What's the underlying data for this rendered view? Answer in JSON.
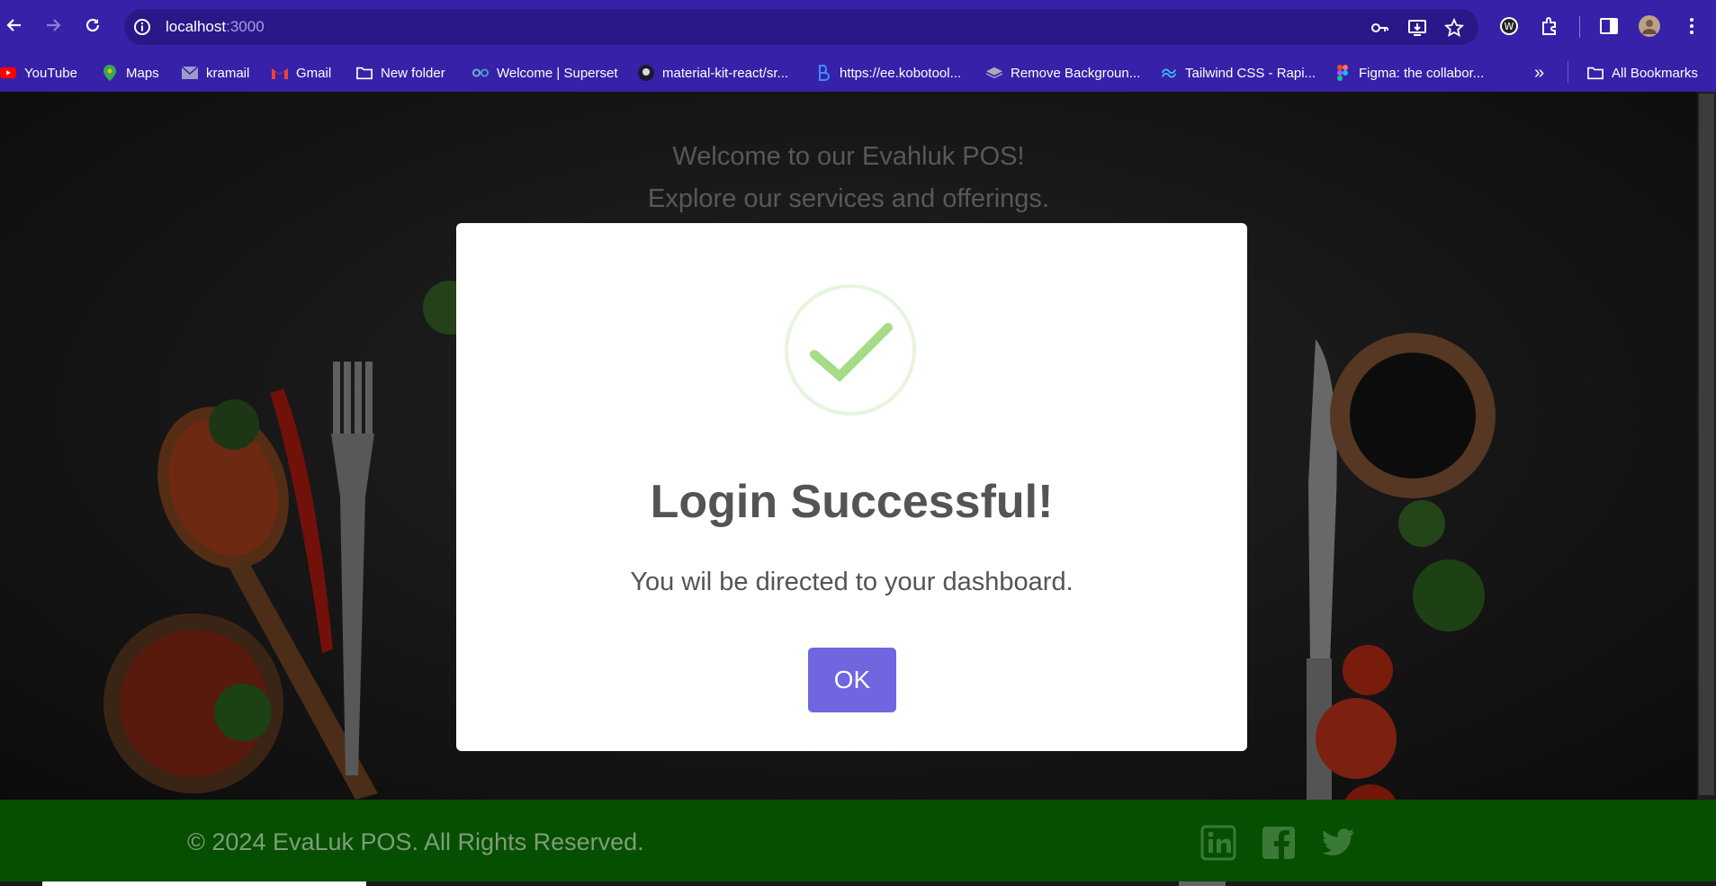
{
  "browser": {
    "url_host": "localhost",
    "url_port": ":3000",
    "bookmarks": [
      {
        "label": "YouTube",
        "icon": "youtube-icon"
      },
      {
        "label": "Maps",
        "icon": "maps-icon"
      },
      {
        "label": "kramail",
        "icon": "mail-icon"
      },
      {
        "label": "Gmail",
        "icon": "gmail-icon"
      },
      {
        "label": "New folder",
        "icon": "folder-icon"
      },
      {
        "label": "Welcome | Superset",
        "icon": "superset-icon"
      },
      {
        "label": "material-kit-react/sr...",
        "icon": "github-icon"
      },
      {
        "label": "https://ee.kobotool...",
        "icon": "kobo-icon"
      },
      {
        "label": "Remove Backgroun...",
        "icon": "layers-icon"
      },
      {
        "label": "Tailwind CSS - Rapi...",
        "icon": "tailwind-icon"
      },
      {
        "label": "Figma: the collabor...",
        "icon": "figma-icon"
      }
    ],
    "all_bookmarks": "All Bookmarks"
  },
  "page": {
    "welcome_line1": "Welcome to our Evahluk POS!",
    "welcome_line2": "Explore our services and offerings."
  },
  "modal": {
    "title": "Login Successful!",
    "message": "You wil be directed to your dashboard.",
    "ok_label": "OK",
    "accent_color": "#7066e0",
    "success_color": "#a5dc86"
  },
  "footer": {
    "copyright": "© 2024 EvaLuk POS. All Rights Reserved.",
    "social": [
      "linkedin-icon",
      "facebook-icon",
      "twitter-icon"
    ]
  }
}
